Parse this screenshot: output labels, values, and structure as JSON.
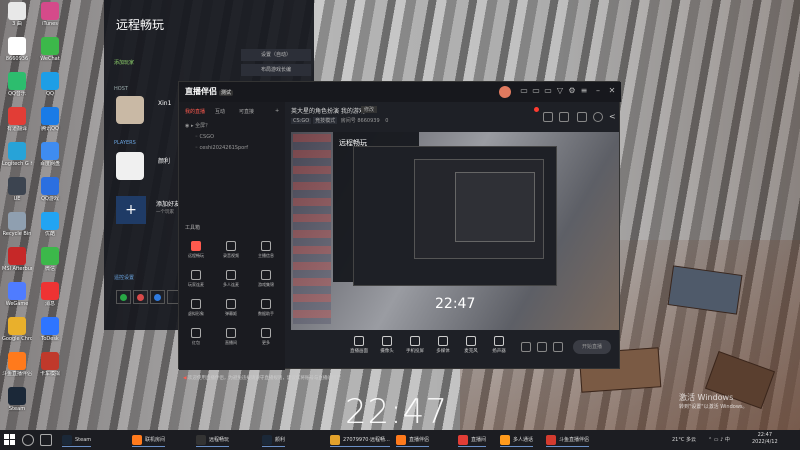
{
  "desktop": {
    "icons": [
      {
        "label": "3 曲",
        "color": "#e8e8e8"
      },
      {
        "label": "8660936",
        "color": "#ffffff"
      },
      {
        "label": "QQ音乐",
        "color": "#2dbd6e"
      },
      {
        "label": "有道翻译",
        "color": "#e23d36"
      },
      {
        "label": "Logitech G HUB",
        "color": "#27a3d8"
      },
      {
        "label": "UE",
        "color": "#3c4450"
      },
      {
        "label": "Recycle Bin",
        "color": "#8f9fb0"
      },
      {
        "label": "MSI Afterburner",
        "color": "#c62828"
      },
      {
        "label": "WeGame",
        "color": "#4f7cff"
      },
      {
        "label": "Google Chrome",
        "color": "#e9b02c"
      },
      {
        "label": "斗鱼直播伴侣",
        "color": "#ff7a1c"
      },
      {
        "label": "Steam",
        "color": "#1b2838"
      },
      {
        "label": "iTunes",
        "color": "#d54a8a"
      },
      {
        "label": "WeChat",
        "color": "#3cb84a"
      },
      {
        "label": "QQ",
        "color": "#1e9ee6"
      },
      {
        "label": "腾讯QQ",
        "color": "#1a7be6"
      },
      {
        "label": "百度网盘",
        "color": "#3f8cf0"
      },
      {
        "label": "QQ游戏",
        "color": "#2b6fe0"
      },
      {
        "label": "优酷",
        "color": "#22a4f2"
      },
      {
        "label": "微信",
        "color": "#3cb84a"
      },
      {
        "label": "消息",
        "color": "#e33"
      },
      {
        "label": "ToDesk",
        "color": "#2e75ff"
      },
      {
        "label": "卡车模拟",
        "color": "#c0392b"
      }
    ]
  },
  "left_panel": {
    "title": "远程畅玩",
    "btn1": "设置（自动）",
    "btn2": "布局游戏长编",
    "section_add": "添加玩家",
    "host_label": "HOST",
    "host_name": "Xin1",
    "players_label": "PLAYERS",
    "player_name": "颜利",
    "add_label": "添加好友",
    "add_sub": "一个玩家",
    "slots_label": "遥控设置"
  },
  "app": {
    "brand": "直播伴侣",
    "brand_badge": "测试",
    "tabs": [
      "我的直播",
      "互动",
      "可直接",
      "+"
    ],
    "tree": [
      "全屏？",
      "CSGO",
      "ceshi2024261Sporf"
    ],
    "toolbox_label": "工具箱",
    "tools": [
      {
        "label": "远程畅玩",
        "hot": true
      },
      {
        "label": "录音视频"
      },
      {
        "label": "主播信息"
      },
      {
        "label": "玩家连麦"
      },
      {
        "label": "多人连麦"
      },
      {
        "label": "游戏集锦"
      },
      {
        "label": "虚拟形象"
      },
      {
        "label": "弹幕姬"
      },
      {
        "label": "数据助手"
      },
      {
        "label": "红包"
      },
      {
        "label": "直播间"
      },
      {
        "label": "更多"
      }
    ],
    "notice": "欢迎使用直播伴侣，为避免违规请遵守直播规则，建议您将账号与直播间绑定",
    "room_title": "英大星的角色扮演 我的游戏",
    "room_tag": "修改",
    "room_meta": {
      "chip1": "CS:GO",
      "chip2": "竞技模式",
      "text": "房间号 8660939",
      "count": "0"
    },
    "preview": {
      "panel_title": "远程畅玩",
      "clock": "22:47"
    },
    "controls": [
      {
        "label": "直播画面"
      },
      {
        "label": "摄像头"
      },
      {
        "label": "手机投屏"
      },
      {
        "label": "多媒体"
      },
      {
        "label": "麦克风"
      },
      {
        "label": "扬声器"
      }
    ],
    "live_btn": "开始直播"
  },
  "clock": "22:47",
  "activate": {
    "line1": "激活 Windows",
    "line2": "转到\"设置\"以激活 Windows。"
  },
  "taskbar": {
    "items": [
      {
        "label": "Steam",
        "color": "#1b2838"
      },
      {
        "label": "联机房间",
        "color": "#ff7a1c"
      },
      {
        "label": "远程畅玩",
        "color": "#333"
      },
      {
        "label": "颜利",
        "color": "#1b2838"
      },
      {
        "label": "27079970·远程畅...",
        "color": "#e2a12b"
      },
      {
        "label": "直播伴侣",
        "color": "#ff7a1c"
      },
      {
        "label": "直播间",
        "color": "#e23d36"
      },
      {
        "label": "多人通话",
        "color": "#ff9a1c"
      },
      {
        "label": "斗鱼直播伴侣",
        "color": "#d43b2f"
      }
    ],
    "weather": "21°C 多云",
    "time": "22:47",
    "date": "2022/4/12"
  }
}
